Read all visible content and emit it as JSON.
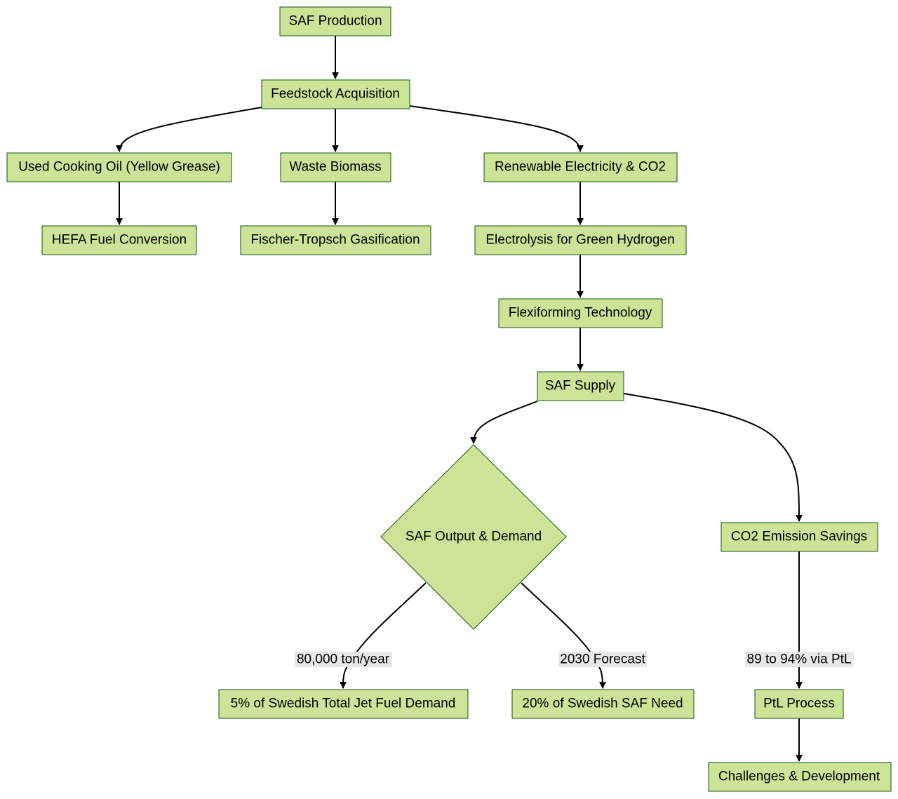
{
  "colors": {
    "node_fill": "#cde498",
    "node_stroke": "#13540c",
    "edge": "#000000",
    "edge_label_bg": "#e8e8e8"
  },
  "nodes": {
    "saf_production": "SAF Production",
    "feedstock_acquisition": "Feedstock Acquisition",
    "used_cooking_oil": "Used Cooking Oil (Yellow Grease)",
    "waste_biomass": "Waste Biomass",
    "renewable_electricity": "Renewable Electricity & CO2",
    "hefa": "HEFA Fuel Conversion",
    "fischer_tropsch": "Fischer-Tropsch Gasification",
    "electrolysis": "Electrolysis for Green Hydrogen",
    "flexiforming": "Flexiforming Technology",
    "saf_supply": "SAF Supply",
    "saf_output_demand": "SAF Output & Demand",
    "co2_savings": "CO2 Emission Savings",
    "swedish_jet_fuel": "5% of Swedish Total Jet Fuel Demand",
    "swedish_saf_need": "20% of Swedish SAF Need",
    "ptl_process": "PtL Process",
    "challenges": "Challenges & Development"
  },
  "edge_labels": {
    "output_to_jet_fuel": "80,000 ton/year",
    "output_to_saf_need": "2030 Forecast",
    "savings_to_ptl": "89 to 94% via PtL"
  }
}
